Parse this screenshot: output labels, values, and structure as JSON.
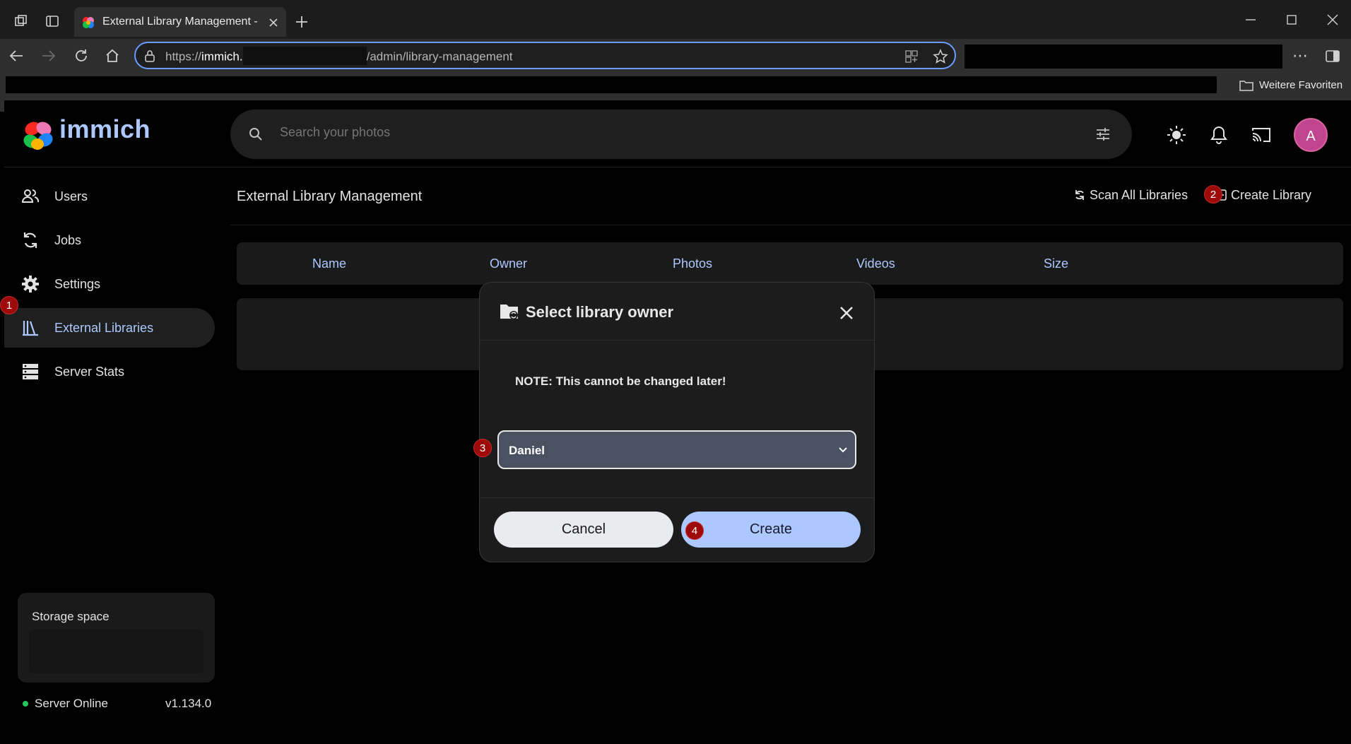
{
  "browser": {
    "tab_title": "External Library Management - Immich",
    "url_prefix": "https://",
    "url_host": "immich.",
    "url_path": "/admin/library-management",
    "favorites_label": "Weitere Favoriten"
  },
  "app": {
    "logo_text": "immich",
    "search_placeholder": "Search your photos",
    "avatar_initial": "A"
  },
  "sidebar": {
    "items": [
      {
        "label": "Users",
        "icon": "users-icon"
      },
      {
        "label": "Jobs",
        "icon": "sync-icon"
      },
      {
        "label": "Settings",
        "icon": "gear-icon"
      },
      {
        "label": "External Libraries",
        "icon": "library-icon"
      },
      {
        "label": "Server Stats",
        "icon": "server-icon"
      }
    ],
    "storage_title": "Storage space",
    "server_status": "Server Online",
    "version": "v1.134.0"
  },
  "main": {
    "page_title": "External Library Management",
    "scan_all_label": "Scan All Libraries",
    "create_library_label": "Create Library",
    "columns": [
      "Name",
      "Owner",
      "Photos",
      "Videos",
      "Size"
    ]
  },
  "modal": {
    "title": "Select library owner",
    "note": "NOTE: This cannot be changed later!",
    "owner_selected": "Daniel",
    "cancel_label": "Cancel",
    "create_label": "Create"
  },
  "annotations": [
    "1",
    "2",
    "3",
    "4"
  ],
  "colors": {
    "accent": "#adc8ff",
    "badge": "#9e0a0a",
    "avatar": "#c0448f",
    "online": "#22c55e"
  }
}
